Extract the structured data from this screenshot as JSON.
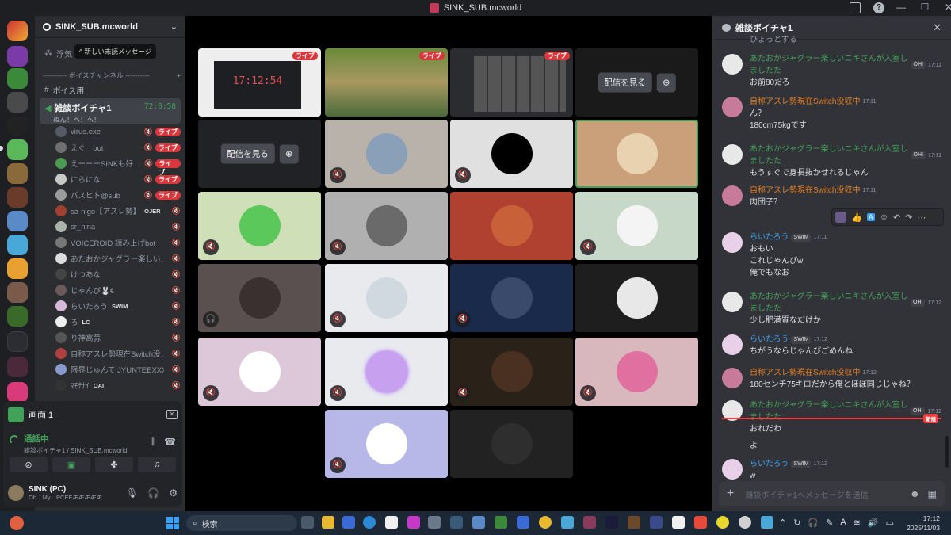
{
  "window": {
    "title": "SINK_SUB.mcworld"
  },
  "sidebar": {
    "guild_name": "SINK_SUB.mcworld",
    "tooltip": "新しい未読メッセージ",
    "channel_partial": "浮気",
    "category": "---------- ボイスチャンネル ----------",
    "voice_text_channel": "ボイス用",
    "voice_channel": {
      "name": "雑談ボイチャ1",
      "timer": "72:0:58",
      "status": "ぬん！ヘ！ヘ！"
    },
    "users": [
      {
        "name": "virus.exe",
        "live": "ライブ",
        "color": "#555b66"
      },
      {
        "name": "えぐ　bot",
        "live": "ライブ",
        "color": "#6f6f6f"
      },
      {
        "name": "えーーーSINKも好…",
        "live": "ライブ",
        "color": "#4a9a50"
      },
      {
        "name": "にらにな",
        "live": "ライブ",
        "color": "#c9c9c9"
      },
      {
        "name": "パスヒト@sub",
        "live": "ライブ",
        "color": "#9c9c9c"
      },
      {
        "name": "sa-nigo【アスレ勢】",
        "tag": "OJER",
        "color": "#a04030"
      },
      {
        "name": "sr_nina",
        "color": "#aab4aa"
      },
      {
        "name": "VOICEROID 読み上げbot",
        "color": "#777"
      },
      {
        "name": "あたおかジャグラー楽しい…",
        "color": "#ddd"
      },
      {
        "name": "けつあな",
        "color": "#444"
      },
      {
        "name": "じゃんぴ🐰€",
        "color": "#6a5a5a"
      },
      {
        "name": "らいたろう",
        "tag": "SWIM",
        "color": "#d8b8d8"
      },
      {
        "name": "ろ",
        "tag": "LC",
        "color": "#eee"
      },
      {
        "name": "り神高蒜",
        "color": "#555"
      },
      {
        "name": "自称アスレ勢現在Switch没…",
        "color": "#b04040"
      },
      {
        "name": "限界じゅんて JYUNTEEXXX",
        "color": "#8899cc"
      },
      {
        "name": "ﾏﾓﾃﾅｲ",
        "tag": "OAI",
        "color": "#333"
      }
    ]
  },
  "panel": {
    "screen_label": "画面 1",
    "call_status": "通話中",
    "call_sub": "雑談ボイチャ1 / SINK_SUB.mcworld",
    "me_name": "SINK (PC)",
    "me_status": "Oh…My…PCEEÆÆÆÆÆ"
  },
  "stage": {
    "live_label": "ライブ",
    "watch_label": "配信を見る",
    "clock": "17:12:54"
  },
  "chat": {
    "channel": "雑談ボイチャ1",
    "placeholder": "雑談ボイチャ1へメッセージを送信",
    "top_partial": "ひょっとする",
    "new_label": "新規",
    "messages": [
      {
        "author": "あたおかジャグラー楽しいニキさんが入室しましたた",
        "badge": "OHI",
        "time": "17:11",
        "color": "#43a25a",
        "lines": [
          "お前80だろ"
        ]
      },
      {
        "author": "自称アスレ勢現在Switch没収中",
        "time": "17:11",
        "color": "#e67e22",
        "lines": [
          "ん？",
          "180cm75kgです"
        ]
      },
      {
        "author": "あたおかジャグラー楽しいニキさんが入室しましたた",
        "badge": "OHI",
        "time": "17:11",
        "color": "#43a25a",
        "lines": [
          "もうすぐで身長抜かせれるじゃん"
        ]
      },
      {
        "author": "自称アスレ勢現在Switch没収中",
        "time": "17:11",
        "color": "#e67e22",
        "lines": [
          "肉団子？"
        ]
      },
      {
        "author": "らいたろう",
        "badge": "SWIM",
        "time": "17:11",
        "color": "#3ba1f5",
        "lines": [
          "おもい",
          "これじゃんぴw",
          "俺でもなお"
        ]
      },
      {
        "author": "あたおかジャグラー楽しいニキさんが入室しましたた",
        "badge": "OHI",
        "time": "17:12",
        "color": "#43a25a",
        "lines": [
          "少し肥満質なだけか"
        ]
      },
      {
        "author": "らいたろう",
        "badge": "SWIM",
        "time": "17:12",
        "color": "#3ba1f5",
        "lines": [
          "ちがうならじゃんぴごめんね"
        ]
      },
      {
        "author": "自称アスレ勢現在Switch没収中",
        "time": "17:12",
        "color": "#e67e22",
        "lines": [
          "180センチ75キロだから俺とほぼ同じじゃね？"
        ]
      },
      {
        "author": "あたおかジャグラー楽しいニキさんが入室しましたた",
        "badge": "OHI",
        "time": "17:12",
        "color": "#43a25a",
        "lines": [
          "おれだわ",
          "よ"
        ]
      },
      {
        "author": "らいたろう",
        "badge": "SWIM",
        "time": "17:12",
        "color": "#3ba1f5",
        "lines": [
          "w"
        ]
      }
    ]
  },
  "taskbar": {
    "search_label": "検索",
    "time": "17:12",
    "date": "2025/11/03",
    "ime": "A"
  }
}
